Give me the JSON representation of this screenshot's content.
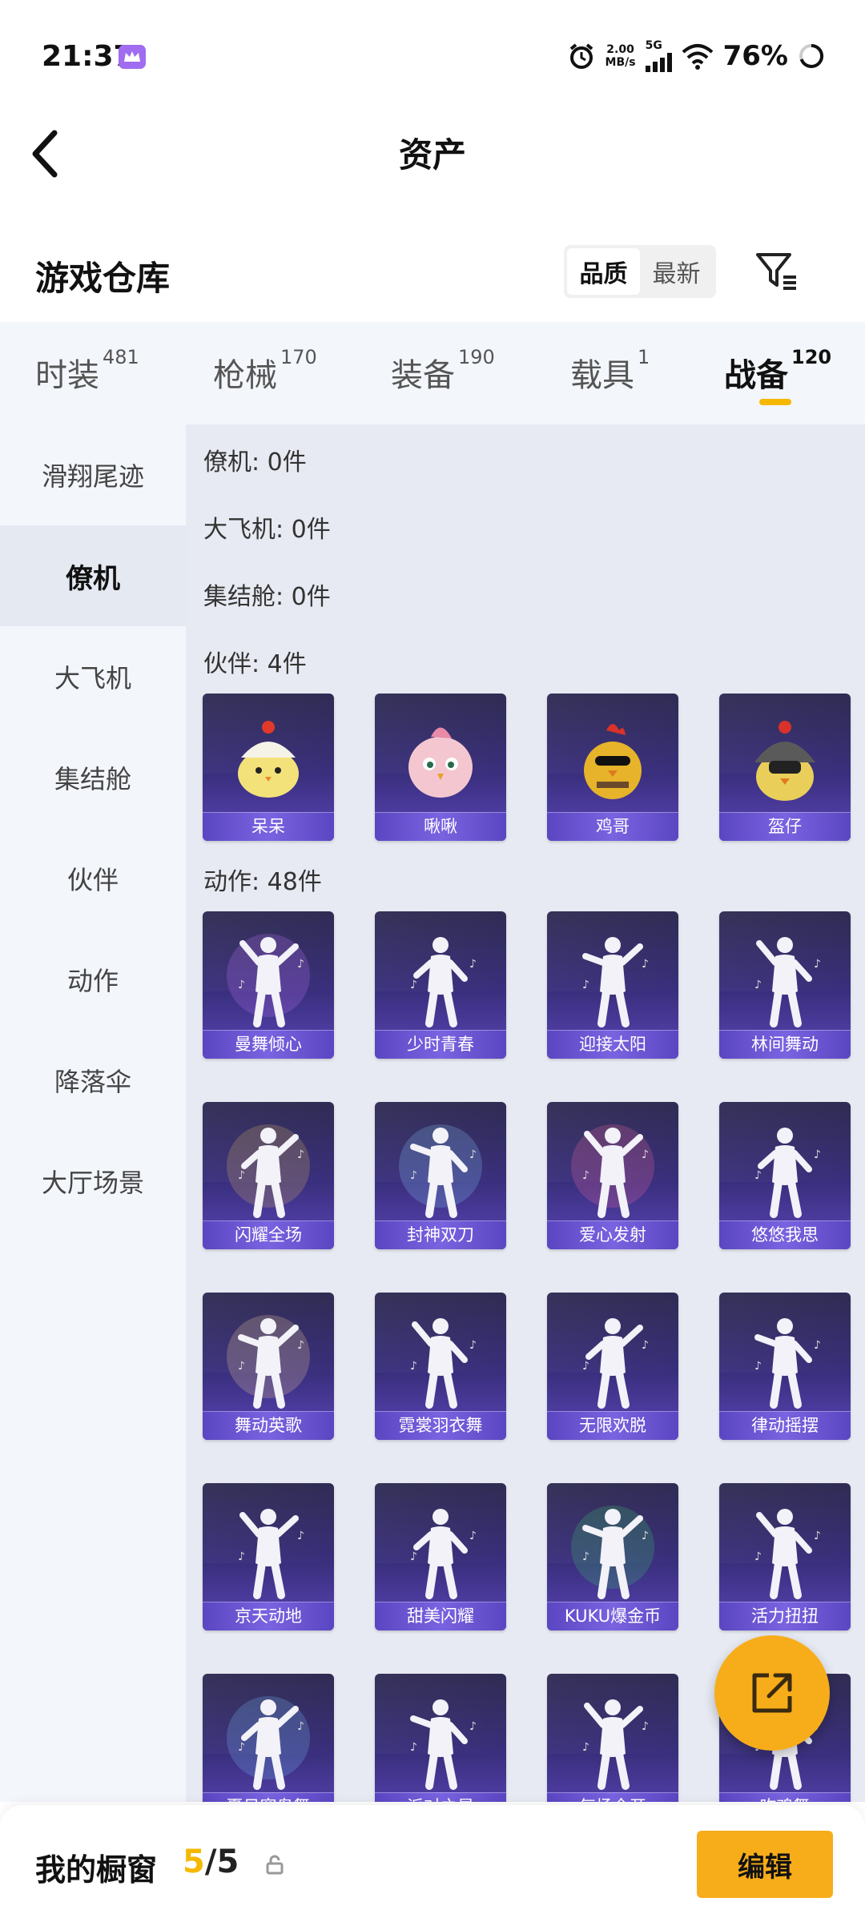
{
  "status_bar": {
    "time": "21:37",
    "speed_value": "2.00",
    "speed_unit": "MB/s",
    "network": "5G",
    "battery": "76%"
  },
  "header": {
    "title": "资产"
  },
  "section": {
    "title": "游戏仓库",
    "sort_quality": "品质",
    "sort_newest": "最新"
  },
  "tabs": [
    {
      "label": "时装",
      "count": "481"
    },
    {
      "label": "枪械",
      "count": "170"
    },
    {
      "label": "装备",
      "count": "190"
    },
    {
      "label": "载具",
      "count": "1"
    },
    {
      "label": "战备",
      "count": "120"
    }
  ],
  "sidebar": [
    "滑翔尾迹",
    "僚机",
    "大飞机",
    "集结舱",
    "伙伴",
    "动作",
    "降落伞",
    "大厅场景"
  ],
  "groups": {
    "wingman": "僚机: 0件",
    "plane": "大飞机: 0件",
    "capsule": "集结舱: 0件",
    "partner": "伙伴: 4件",
    "emote": "动作: 48件"
  },
  "partners": [
    "呆呆",
    "啾啾",
    "鸡哥",
    "盔仔"
  ],
  "emotes": [
    "曼舞倾心",
    "少时青春",
    "迎接太阳",
    "林间舞动",
    "闪耀全场",
    "封神双刀",
    "爱心发射",
    "悠悠我思",
    "舞动英歌",
    "霓裳羽衣舞",
    "无限欢脱",
    "律动摇摆",
    "京天动地",
    "甜美闪耀",
    "KUKU爆金币",
    "活力扭扭",
    "夏日窈袅舞",
    "派对之星",
    "气场全开",
    "吃鸡舞"
  ],
  "showcase": {
    "label": "我的橱窗",
    "used": "5",
    "total": "/5",
    "edit": "编辑"
  },
  "colors": {
    "accent": "#f7ad1a",
    "card_top": "#25214a",
    "card_bottom": "#5a45b8"
  }
}
